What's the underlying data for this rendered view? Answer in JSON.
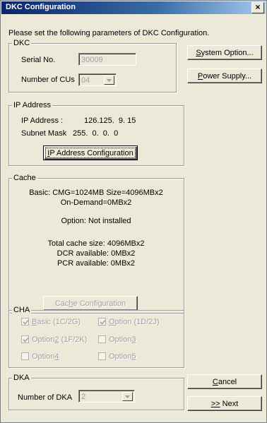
{
  "window": {
    "title": "DKC Configuration",
    "close_glyph": "×"
  },
  "intro": "Please set the following parameters of DKC Configuration.",
  "dkc": {
    "legend": "DKC",
    "serial_label": "Serial No.",
    "serial_value": "30009",
    "cus_label": "Number of CUs",
    "cus_value": "04"
  },
  "buttons": {
    "system_option": {
      "accel": "S",
      "rest": "ystem Option..."
    },
    "power_supply": {
      "accel": "P",
      "rest": "ower Supply..."
    },
    "ip_config": {
      "accel": "I",
      "rest": "P Address Configuration"
    },
    "cache_config": {
      "pre": "Cac",
      "accel": "h",
      "rest": "e Configuration"
    },
    "cancel": {
      "accel": "C",
      "rest": "ancel"
    },
    "next": {
      "accel": ">>",
      "rest": " Next"
    }
  },
  "ip": {
    "legend": "IP Address",
    "ip_label": "IP Address :",
    "ip_value": "126.125.  9. 15",
    "mask_label": "Subnet Mask",
    "mask_value": "255.  0.  0.  0"
  },
  "cache": {
    "legend": "Cache",
    "basic_line1": "Basic: CMG=1024MB Size=4096MBx2",
    "basic_line2": "On-Demand=0MBx2",
    "option": "Option: Not installed",
    "total": "Total cache size: 4096MBx2",
    "dcr": "DCR available: 0MBx2",
    "pcr": "PCR available: 0MBx2"
  },
  "cha": {
    "legend": "CHA",
    "items": [
      {
        "pre": "",
        "accel": "B",
        "rest": "asic (1C/2G)",
        "checked": true
      },
      {
        "pre": "",
        "accel": "O",
        "rest": "ption (1D/2J)",
        "checked": true
      },
      {
        "pre": "Option",
        "accel": "2",
        "rest": " (1F/2K)",
        "checked": true
      },
      {
        "pre": "Option",
        "accel": "3",
        "rest": "",
        "checked": false
      },
      {
        "pre": "Option",
        "accel": "4",
        "rest": "",
        "checked": false
      },
      {
        "pre": "Option",
        "accel": "5",
        "rest": "",
        "checked": false
      }
    ]
  },
  "dka": {
    "legend": "DKA",
    "count_label": "Number of DKA",
    "count_value": "2"
  },
  "icons": [
    "close-icon",
    "dropdown-arrow-icon",
    "checkmark-icon"
  ]
}
